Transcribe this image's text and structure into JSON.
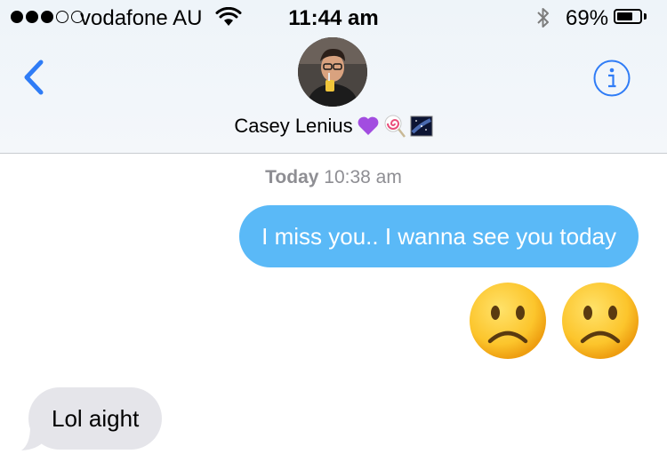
{
  "status_bar": {
    "carrier": "vodafone AU",
    "time": "11:44 am",
    "battery_percent": "69%",
    "battery_level": 0.69,
    "signal_bars_filled": 3,
    "signal_bars_total": 5
  },
  "nav": {
    "back_icon": "chevron-left-icon",
    "info_icon": "info-icon",
    "accent_color": "#2f7cf6"
  },
  "contact": {
    "name": "Casey Lenius",
    "name_emojis": [
      "purple-heart-icon",
      "lollipop-icon",
      "milky-way-icon"
    ]
  },
  "thread": {
    "timestamp_day": "Today",
    "timestamp_time": "10:38 am",
    "messages": [
      {
        "direction": "outgoing",
        "text": "I miss you.. I wanna see you today",
        "bubble_color": "#5ab9f7"
      },
      {
        "direction": "outgoing",
        "emoji": [
          "frowning-face-icon",
          "frowning-face-icon"
        ]
      },
      {
        "direction": "incoming",
        "text": "Lol aight",
        "bubble_color": "#e5e5ea"
      }
    ]
  }
}
